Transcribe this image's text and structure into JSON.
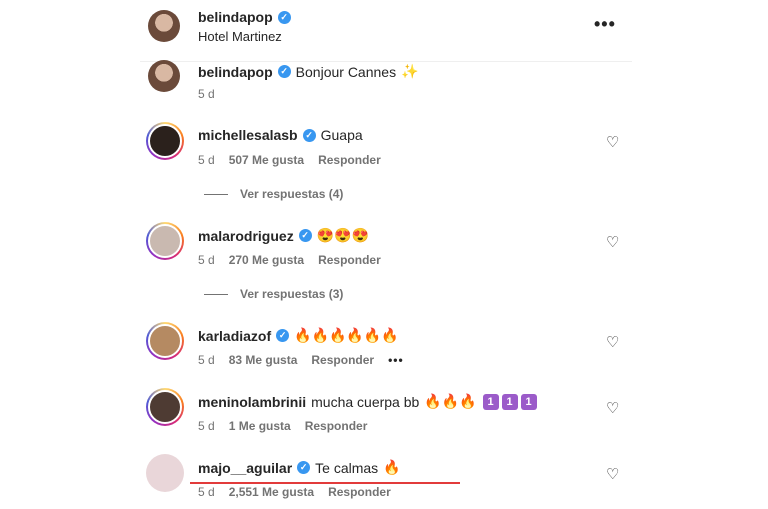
{
  "post": {
    "username": "belindapop",
    "location": "Hotel Martinez",
    "more_label": "•••",
    "caption_user": "belindapop",
    "caption_text": "Bonjour Cannes",
    "caption_emoji": "✨",
    "caption_time": "5 d"
  },
  "comments": [
    {
      "user": "michellesalasb",
      "verified": true,
      "text": "Guapa",
      "emoji": "",
      "time": "5 d",
      "likes": "507 Me gusta",
      "reply": "Responder",
      "replies_label": "Ver respuestas (4)",
      "avatar_color": "#2b211c"
    },
    {
      "user": "malarodriguez",
      "verified": true,
      "text": "",
      "emoji": "😍😍😍",
      "time": "5 d",
      "likes": "270 Me gusta",
      "reply": "Responder",
      "replies_label": "Ver respuestas (3)",
      "avatar_color": "#c9b9b0"
    },
    {
      "user": "karladiazof",
      "verified": true,
      "text": "",
      "emoji": "🔥🔥🔥🔥🔥🔥",
      "time": "5 d",
      "likes": "83 Me gusta",
      "reply": "Responder",
      "more": "•••",
      "avatar_color": "#b58a62"
    },
    {
      "user": "meninolambrinii",
      "verified": false,
      "text": "mucha cuerpa bb",
      "emoji": "🔥🔥🔥",
      "badges": [
        "1",
        "1",
        "1"
      ],
      "time": "5 d",
      "likes": "1 Me gusta",
      "reply": "Responder",
      "avatar_color": "#4e3b33"
    },
    {
      "user": "majo__aguilar",
      "verified": true,
      "text": "Te calmas",
      "emoji": "🔥",
      "time": "5 d",
      "likes": "2,551 Me gusta",
      "reply": "Responder",
      "avatar_color": "#e9d6d9"
    }
  ],
  "colors": {
    "verified": "#3897f0",
    "highlight_underline": "#e23b3b",
    "meta_text": "#737373"
  },
  "icons": {
    "like": "heart-icon",
    "verified": "verified-badge-icon",
    "more": "more-options-icon"
  }
}
